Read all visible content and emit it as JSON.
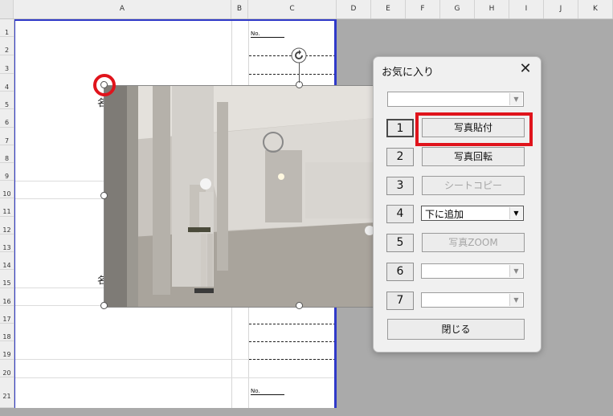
{
  "spreadsheet": {
    "columns": [
      "A",
      "B",
      "C",
      "D",
      "E",
      "F",
      "G",
      "H",
      "I",
      "J",
      "K"
    ],
    "rows": [
      "1",
      "2",
      "3",
      "4",
      "5",
      "6",
      "7",
      "8",
      "9",
      "10",
      "11",
      "12",
      "13",
      "14",
      "15",
      "16",
      "17",
      "18",
      "19",
      "20",
      "21"
    ],
    "no_label_1": "No.",
    "no_label_2": "No.",
    "cell_text_1": "名",
    "cell_text_2": "名"
  },
  "dialog": {
    "title": "お気に入り",
    "close_glyph": "✕",
    "top_combo_value": "",
    "buttons": [
      {
        "num": "1",
        "label": "写真貼付",
        "enabled": true
      },
      {
        "num": "2",
        "label": "写真回転",
        "enabled": true
      },
      {
        "num": "3",
        "label": "シートコピー",
        "enabled": false
      },
      {
        "num": "4",
        "label": "下に追加",
        "enabled": true,
        "is_combo": true
      },
      {
        "num": "5",
        "label": "写真ZOOM",
        "enabled": false
      },
      {
        "num": "6",
        "label": "",
        "enabled": true,
        "is_combo": true
      },
      {
        "num": "7",
        "label": "",
        "enabled": true,
        "is_combo": true
      }
    ],
    "close_button": "閉じる",
    "combo_arrow": "▼"
  },
  "colors": {
    "highlight_red": "#e0141c",
    "print_border_blue": "#2f39c8"
  }
}
